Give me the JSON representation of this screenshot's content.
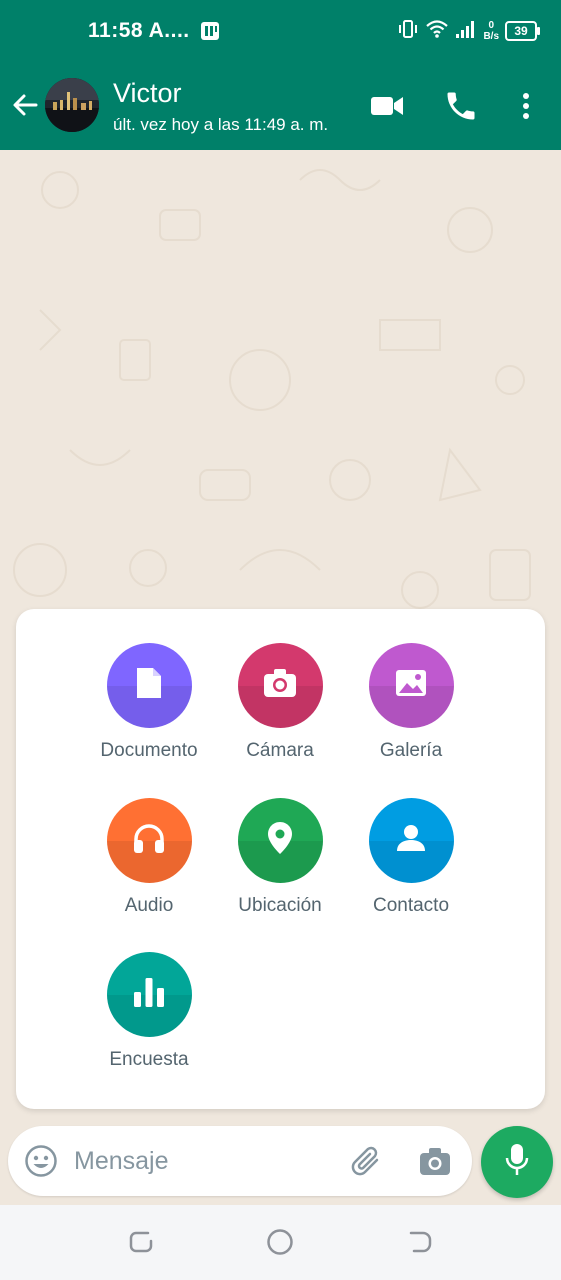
{
  "status_bar": {
    "time": "11:58 A....",
    "speed_value": "0",
    "speed_unit": "B/s",
    "battery": "39"
  },
  "header": {
    "contact_name": "Victor",
    "last_seen": "últ. vez hoy a las 11:49 a. m."
  },
  "attach_menu": {
    "items": [
      {
        "label": "Documento",
        "icon": "document-icon",
        "color": "#7f66ff"
      },
      {
        "label": "Cámara",
        "icon": "camera-icon",
        "color": "#d3396d"
      },
      {
        "label": "Galería",
        "icon": "gallery-icon",
        "color": "#bf59cf"
      },
      {
        "label": "Audio",
        "icon": "headphones-icon",
        "color": "#ff7033"
      },
      {
        "label": "Ubicación",
        "icon": "location-pin-icon",
        "color": "#1fa855"
      },
      {
        "label": "Contacto",
        "icon": "person-icon",
        "color": "#009de2"
      },
      {
        "label": "Encuesta",
        "icon": "poll-icon",
        "color": "#02a698"
      }
    ]
  },
  "composer": {
    "placeholder": "Mensaje",
    "value": ""
  },
  "colors": {
    "brand": "#008069",
    "chat_bg": "#efe7dd",
    "send_button": "#1daa61"
  }
}
